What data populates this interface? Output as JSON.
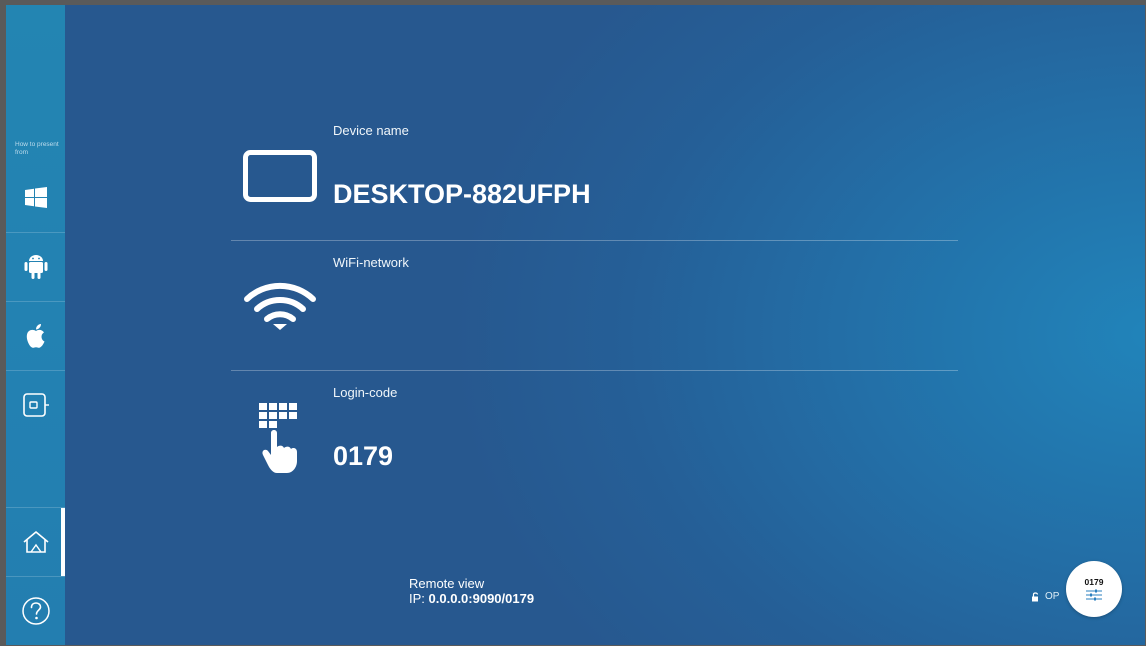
{
  "sidebar": {
    "heading": "How to present from",
    "items": [
      {
        "name": "windows",
        "icon": "windows-logo-icon"
      },
      {
        "name": "android",
        "icon": "android-logo-icon"
      },
      {
        "name": "apple",
        "icon": "apple-logo-icon"
      },
      {
        "name": "hdmi-input",
        "icon": "hdmi-input-icon"
      },
      {
        "name": "home",
        "icon": "home-icon"
      },
      {
        "name": "help",
        "icon": "help-icon"
      }
    ]
  },
  "main": {
    "device": {
      "label": "Device name",
      "value": "DESKTOP-882UFPH",
      "icon": "tablet-icon"
    },
    "wifi": {
      "label": "WiFi-network",
      "value": "",
      "icon": "wifi-icon"
    },
    "login": {
      "label": "Login-code",
      "value": "0179",
      "icon": "keypad-hand-icon"
    }
  },
  "footer": {
    "remote_title": "Remote view",
    "ip_label": "IP:",
    "ip_value": "0.0.0.0:9090/0179",
    "lock_text": "OP",
    "fab_code": "0179"
  },
  "colors": {
    "accent_bg": "#255f97",
    "sidebar_bg": "#2383b2"
  }
}
